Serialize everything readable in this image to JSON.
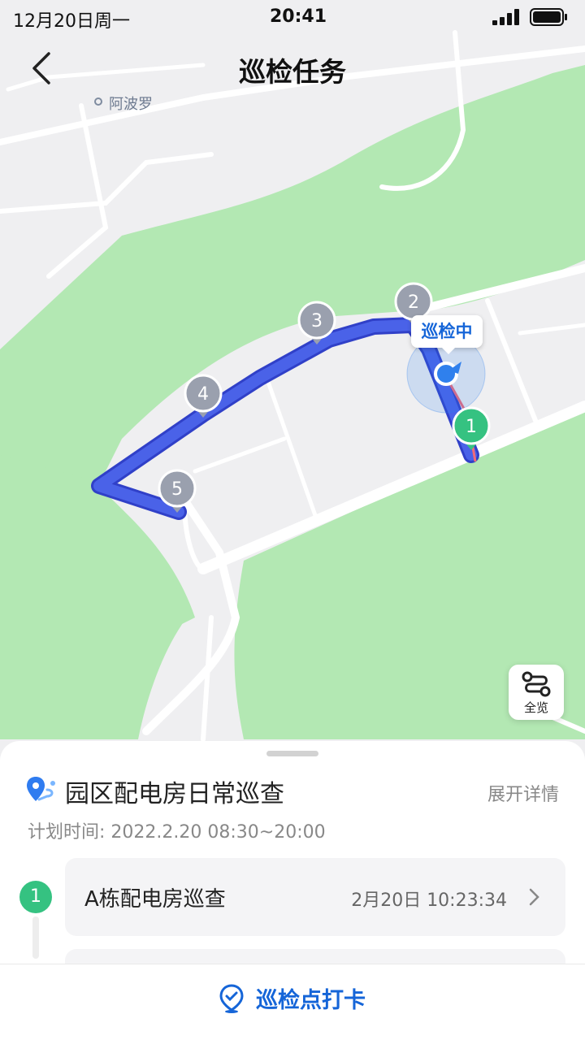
{
  "status_bar": {
    "date": "12月20日周一",
    "time": "20:41"
  },
  "nav": {
    "title": "巡检任务"
  },
  "map": {
    "poi_label": "阿波罗",
    "status_bubble": "巡检中",
    "overview_label": "全览",
    "markers": [
      {
        "label": "1",
        "color": "#35c281"
      },
      {
        "label": "2",
        "color": "#9aa0ae"
      },
      {
        "label": "3",
        "color": "#9aa0ae"
      },
      {
        "label": "4",
        "color": "#9aa0ae"
      },
      {
        "label": "5",
        "color": "#9aa0ae"
      }
    ],
    "colors": {
      "route": "#4a62e8",
      "park": "#b3e8b3",
      "road": "#ffffff",
      "current_location": "#2f80ed"
    }
  },
  "task": {
    "title": "园区配电房日常巡查",
    "expand_label": "展开详情",
    "plan_time": "计划时间: 2022.2.20 08:30~20:00"
  },
  "steps": [
    {
      "number": "1",
      "name": "A栋配电房巡查",
      "time": "2月20日 10:23:34"
    }
  ],
  "bottom": {
    "checkin_label": "巡检点打卡"
  },
  "colors": {
    "accent": "#1565d8",
    "done": "#35c281"
  }
}
